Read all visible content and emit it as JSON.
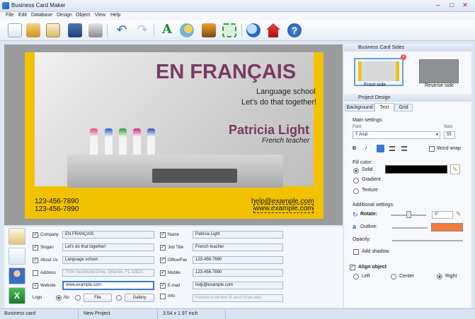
{
  "window": {
    "title": "Business Card Maker",
    "buttons": [
      "–",
      "□",
      "✕"
    ]
  },
  "menu": [
    "File",
    "Edit",
    "Database",
    "Design",
    "Object",
    "View",
    "Help"
  ],
  "card": {
    "heading": "EN FRANÇAIS",
    "line1": "Language school",
    "line2": "Let's do that together!",
    "name": "Patricia Light",
    "job": "French teacher",
    "phone1": "123-456-7890",
    "phone2": "123-456-7890",
    "email": "help@example.com",
    "website": "www.example.com"
  },
  "right": {
    "sides_header": "Business Card Sides",
    "front": "Front side",
    "reverse": "Reverse side",
    "design_header": "Project Design",
    "tabs": [
      "Background",
      "Text",
      "Grid"
    ],
    "main_settings": "Main settings:",
    "font_label": "Font:",
    "font_value": "Arial",
    "size_label": "Size:",
    "size_value": "55",
    "word_wrap": "Word wrap",
    "fill_color": "Fill color:",
    "solid": "Solid",
    "gradient": "Gradient",
    "texture": "Texture",
    "additional": "Additional settings:",
    "rotate": "Rotate:",
    "rotate_value": "0°",
    "outline": "Outline:",
    "opacity": "Opacity:",
    "add_shadow": "Add shadow",
    "align_object": "Align object",
    "left": "Left",
    "center": "Center",
    "right": "Right",
    "colors": {
      "fill": "#000000",
      "outline": "#f47a3a"
    }
  },
  "form": {
    "left_fields": [
      {
        "label": "Company",
        "value": "EN FRANÇAIS",
        "checked": true
      },
      {
        "label": "Slogan",
        "value": "Let's do that together!",
        "checked": true
      },
      {
        "label": "About Us",
        "value": "Language school",
        "checked": true
      },
      {
        "label": "Address",
        "value": "7004 SeaWorld Drive, Orlando, FL 32821",
        "checked": false
      },
      {
        "label": "Website",
        "value": "www.example.com",
        "checked": true
      }
    ],
    "right_fields": [
      {
        "label": "Name",
        "value": "Patricia Light",
        "checked": true
      },
      {
        "label": "Job Title",
        "value": "French teacher",
        "checked": true
      },
      {
        "label": "Office/Fax",
        "value": "123-456-7890",
        "checked": true
      },
      {
        "label": "Mobile",
        "value": "123-456-7890",
        "checked": true
      },
      {
        "label": "E-mail",
        "value": "help@example.com",
        "checked": true
      },
      {
        "label": "Info",
        "value": "Feel free to call from 11 am to 19 pm daily",
        "checked": false
      }
    ],
    "logo_label": "Logo",
    "no_label": "No",
    "file_btn": "File",
    "gallery_btn": "Gallery"
  },
  "status": {
    "left": "Business card",
    "project": "New Project",
    "size": "3.54 x 1.97 inch"
  }
}
